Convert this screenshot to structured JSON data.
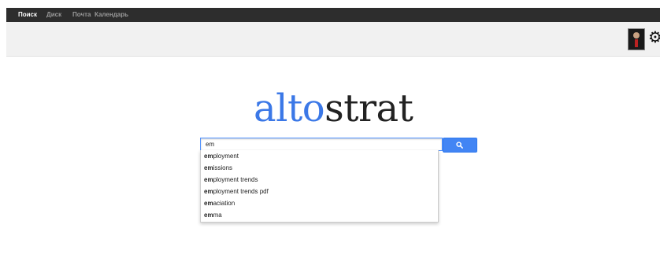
{
  "nav": {
    "items": [
      {
        "label": "Поиск",
        "active": true
      },
      {
        "label": "Диск",
        "active": false
      },
      {
        "label": "Почта",
        "active": false
      },
      {
        "label": "Календарь",
        "active": false
      }
    ]
  },
  "header": {
    "avatar": "user-avatar",
    "settings_icon": "gear-icon"
  },
  "logo": {
    "part1": "alto",
    "part2": "strat",
    "color1": "#3b78e7",
    "color2": "#222222"
  },
  "search": {
    "value": "em",
    "button_icon": "magnifier-icon",
    "button_color": "#4285f4"
  },
  "suggestions": [
    {
      "prefix": "em",
      "rest": "ployment"
    },
    {
      "prefix": "em",
      "rest": "issions"
    },
    {
      "prefix": "em",
      "rest": "ployment trends"
    },
    {
      "prefix": "em",
      "rest": "ployment trends pdf"
    },
    {
      "prefix": "em",
      "rest": "aciation"
    },
    {
      "prefix": "em",
      "rest": "ma"
    }
  ]
}
